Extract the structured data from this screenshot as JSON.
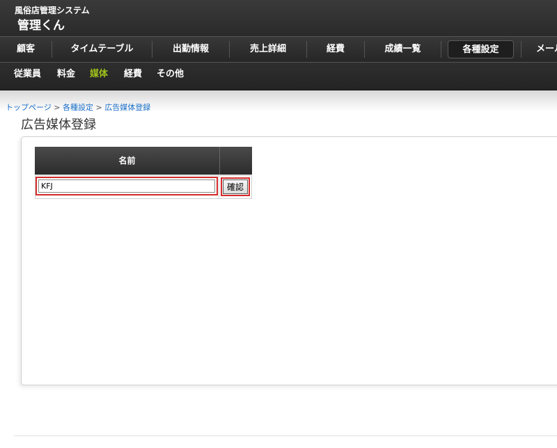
{
  "app": {
    "subtitle": "風俗店管理システム",
    "title": "管理くん"
  },
  "main_nav": {
    "items": [
      {
        "label": "顧客"
      },
      {
        "label": "タイムテーブル"
      },
      {
        "label": "出勤情報"
      },
      {
        "label": "売上詳細"
      },
      {
        "label": "経費"
      },
      {
        "label": "成績一覧"
      },
      {
        "label": "各種設定",
        "active": true
      },
      {
        "label": "メール"
      }
    ]
  },
  "sub_nav": {
    "items": [
      {
        "label": "従業員"
      },
      {
        "label": "料金"
      },
      {
        "label": "媒体",
        "active": true
      },
      {
        "label": "経費"
      },
      {
        "label": "その他"
      }
    ],
    "active_color": "#9ec21a"
  },
  "breadcrumb": {
    "top": "トップページ",
    "settings": "各種設定",
    "current": "広告媒体登録",
    "separator": ">"
  },
  "page": {
    "title": "広告媒体登録"
  },
  "form": {
    "name_header": "名前",
    "name_value": "KFJ",
    "confirm_label": "確認"
  },
  "colors": {
    "highlight": "#d42b2b",
    "link": "#1a6fc9"
  }
}
